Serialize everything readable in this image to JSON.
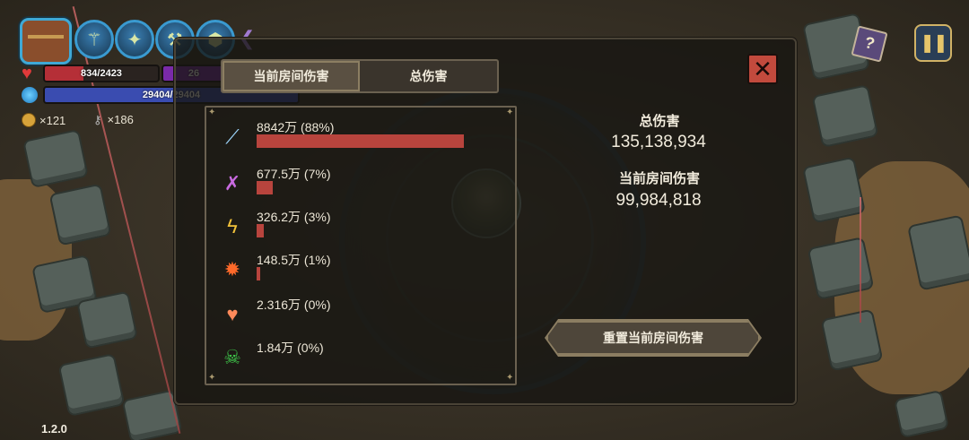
{
  "hud": {
    "hp_text": "834/2423",
    "hp_fraction": 0.344,
    "shield_text": "26",
    "mana_text": "29404/29404",
    "mana_fraction": 1.0,
    "coins": "×121",
    "keys": "×186",
    "icons": [
      "chest-icon",
      "staff-skill-icon",
      "shuriken-skill-icon",
      "wand-skill-icon",
      "orb-skill-icon",
      "collapse-arrow-icon",
      "heart-icon",
      "mana-orb-icon",
      "coin-icon",
      "key-icon",
      "spellbook-icon",
      "pause-icon"
    ]
  },
  "version": "1.2.0",
  "panel": {
    "tabs": [
      {
        "label": "当前房间伤害",
        "active": true
      },
      {
        "label": "总伤害",
        "active": false
      }
    ],
    "close_label": "✕",
    "damage_rows": [
      {
        "label": "8842万 (88%)",
        "share": 0.88,
        "icon": "ice-shard-icon"
      },
      {
        "label": "677.5万 (7%)",
        "share": 0.07,
        "icon": "purple-blades-icon"
      },
      {
        "label": "326.2万 (3%)",
        "share": 0.03,
        "icon": "lightning-crystal-icon"
      },
      {
        "label": "148.5万 (1%)",
        "share": 0.01,
        "icon": "flame-burst-icon"
      },
      {
        "label": "2.316万 (0%)",
        "share": 0.0,
        "icon": "heart-burst-icon"
      },
      {
        "label": "1.84万 (0%)",
        "share": 0.0,
        "icon": "green-skull-icon"
      }
    ],
    "total_label": "总伤害",
    "total_value": "135,138,934",
    "room_label": "当前房间伤害",
    "room_value": "99,984,818",
    "reset_label": "重置当前房间伤害"
  }
}
